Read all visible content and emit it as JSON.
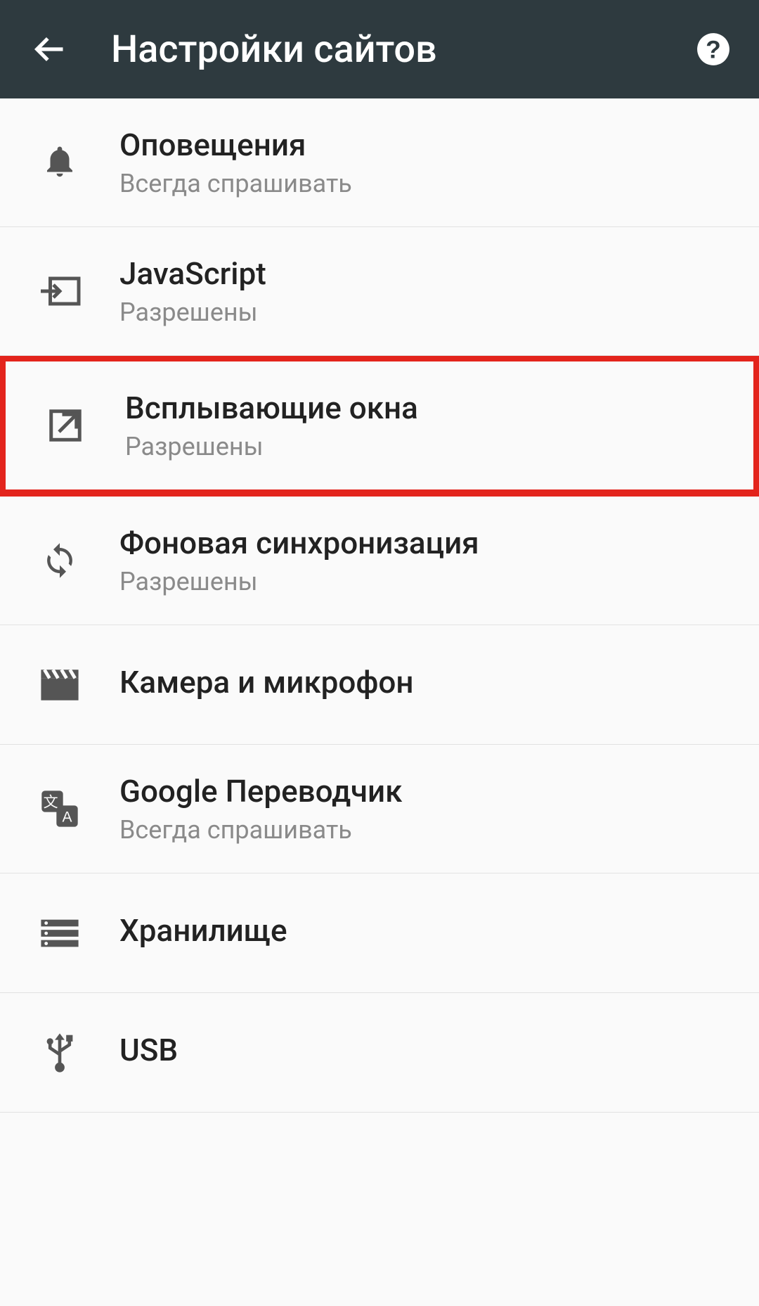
{
  "header": {
    "title": "Настройки сайтов"
  },
  "items": [
    {
      "icon": "bell",
      "title": "Оповещения",
      "subtitle": "Всегда спрашивать",
      "highlight": false
    },
    {
      "icon": "javascript",
      "title": "JavaScript",
      "subtitle": "Разрешены",
      "highlight": false
    },
    {
      "icon": "popup",
      "title": "Всплывающие окна",
      "subtitle": "Разрешены",
      "highlight": true
    },
    {
      "icon": "sync",
      "title": "Фоновая синхронизация",
      "subtitle": "Разрешены",
      "highlight": false
    },
    {
      "icon": "camera",
      "title": "Камера и микрофон",
      "subtitle": "",
      "highlight": false
    },
    {
      "icon": "translate",
      "title": "Google Переводчик",
      "subtitle": "Всегда спрашивать",
      "highlight": false
    },
    {
      "icon": "storage",
      "title": "Хранилище",
      "subtitle": "",
      "highlight": false
    },
    {
      "icon": "usb",
      "title": "USB",
      "subtitle": "",
      "highlight": false
    }
  ]
}
